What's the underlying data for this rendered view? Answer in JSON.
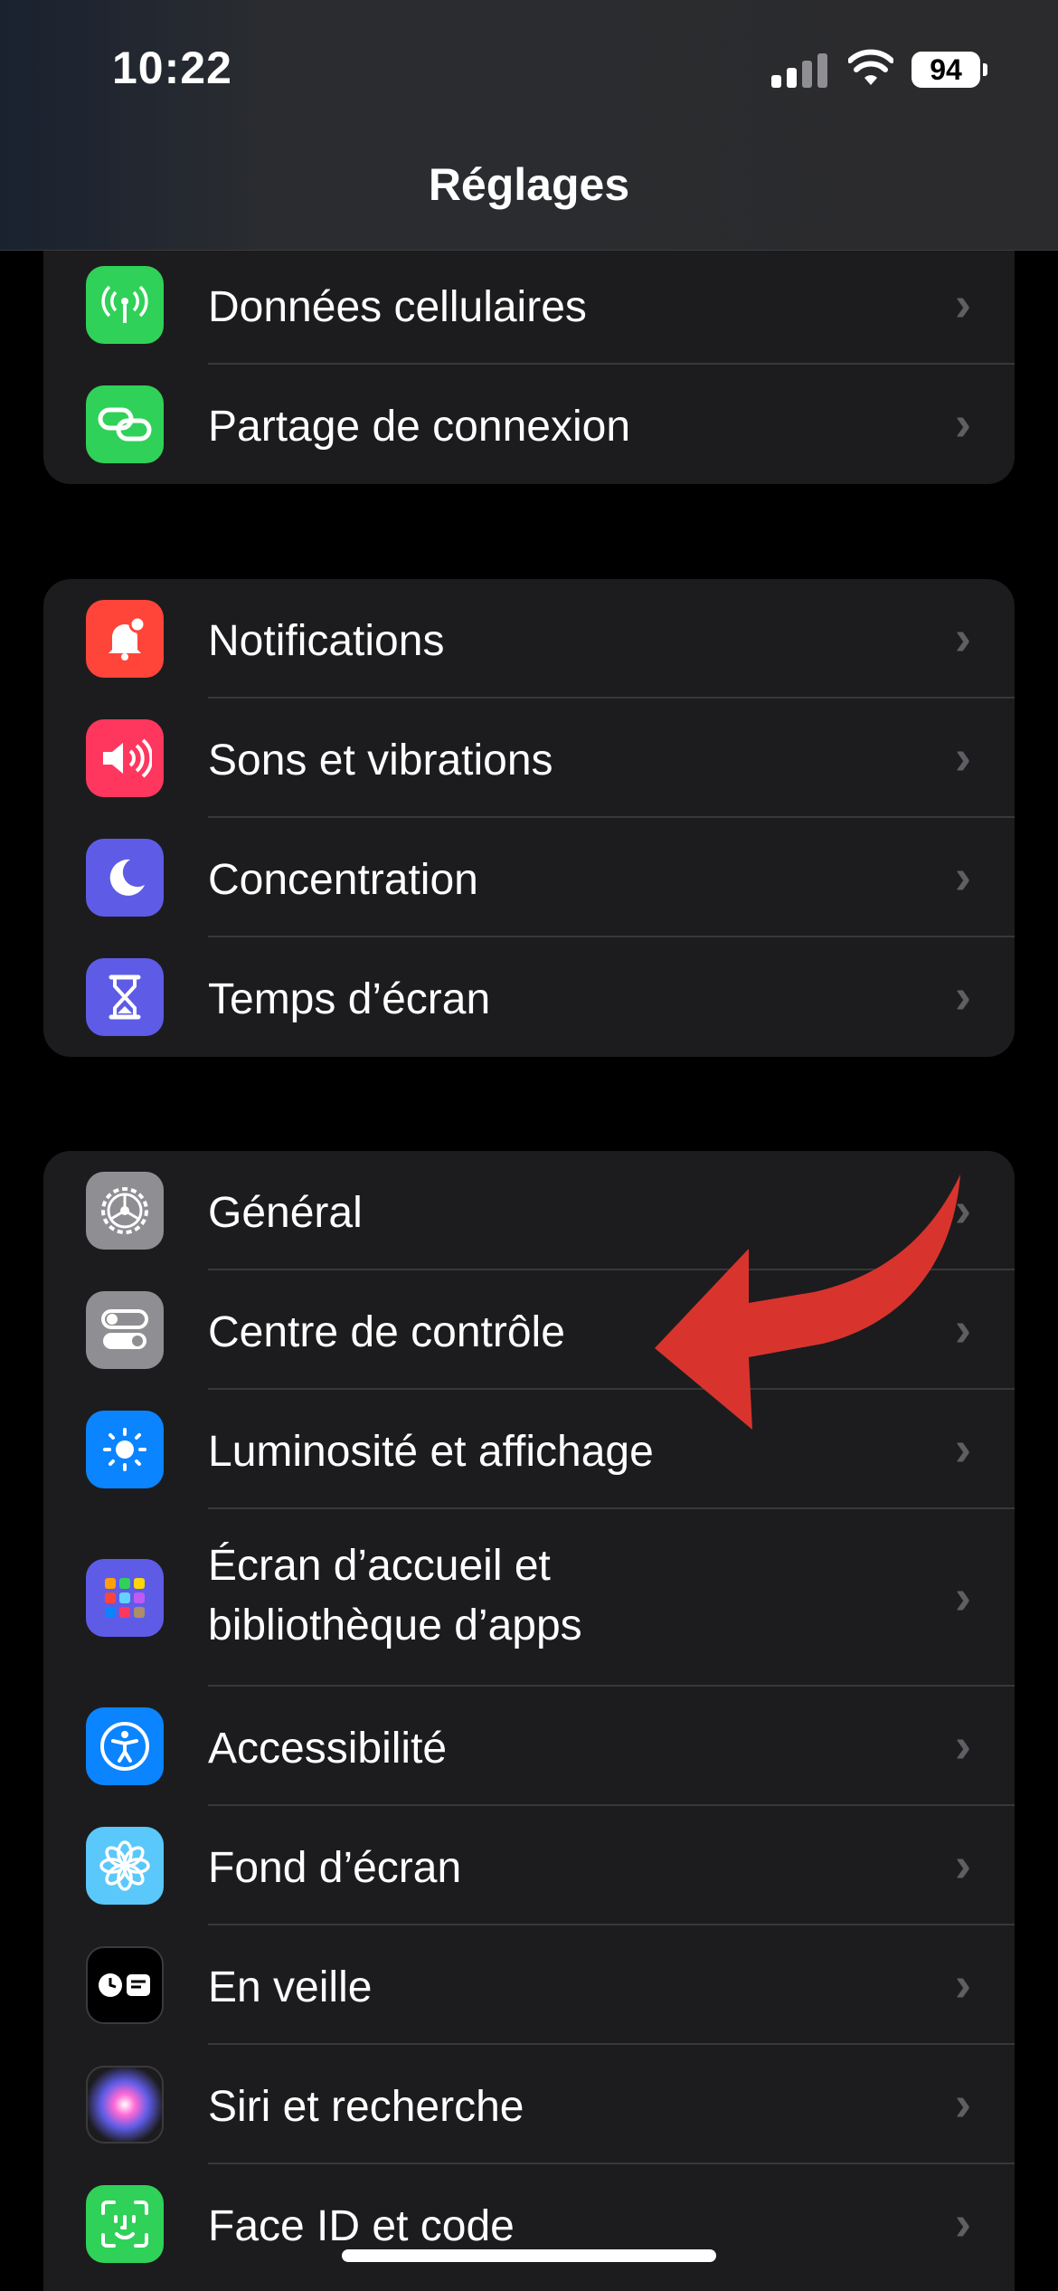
{
  "status_bar": {
    "time": "10:22",
    "battery": "94"
  },
  "nav": {
    "title": "Réglages"
  },
  "groups": [
    {
      "items": [
        {
          "label": "Données cellulaires",
          "icon": "antenna-icon",
          "color": "#30d158"
        },
        {
          "label": "Partage de connexion",
          "icon": "link-icon",
          "color": "#30d158"
        }
      ]
    },
    {
      "items": [
        {
          "label": "Notifications",
          "icon": "bell-icon",
          "color": "#ff453a"
        },
        {
          "label": "Sons et vibrations",
          "icon": "speaker-icon",
          "color": "#ff375f"
        },
        {
          "label": "Concentration",
          "icon": "moon-icon",
          "color": "#5e5ce6"
        },
        {
          "label": "Temps d’écran",
          "icon": "hourglass-icon",
          "color": "#5e5ce6"
        }
      ]
    },
    {
      "items": [
        {
          "label": "Général",
          "icon": "gear-icon",
          "color": "#8e8e93"
        },
        {
          "label": "Centre de contrôle",
          "icon": "toggles-icon",
          "color": "#8e8e93"
        },
        {
          "label": "Luminosité et affichage",
          "icon": "sun-icon",
          "color": "#0a84ff"
        },
        {
          "label": "Écran d’accueil et bibliothèque d’apps",
          "line1": "Écran d’accueil et",
          "line2": "bibliothèque d’apps",
          "icon": "app-grid-icon",
          "color": "#5e5ce6"
        },
        {
          "label": "Accessibilité",
          "icon": "accessibility-icon",
          "color": "#0a84ff"
        },
        {
          "label": "Fond d’écran",
          "icon": "flower-icon",
          "color": "#5ac8fa"
        },
        {
          "label": "En veille",
          "icon": "standby-icon",
          "color": "#000000"
        },
        {
          "label": "Siri et recherche",
          "icon": "siri-icon",
          "color": "#1c1c1e"
        },
        {
          "label": "Face ID et code",
          "icon": "face-id-icon",
          "color": "#30d158"
        }
      ]
    }
  ],
  "chevron": "›",
  "annotation_arrow_color": "#d8342d"
}
